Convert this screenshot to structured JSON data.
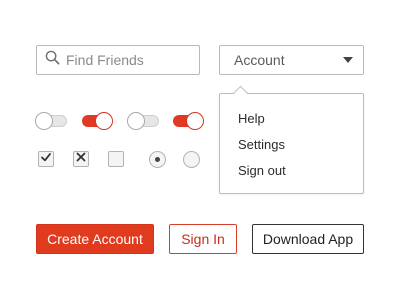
{
  "search": {
    "placeholder": "Find Friends",
    "value": "",
    "icon": "search-icon"
  },
  "account_select": {
    "selected": "Account",
    "icon": "caret-down-icon"
  },
  "account_menu": {
    "items": [
      {
        "label": "Help"
      },
      {
        "label": "Settings"
      },
      {
        "label": "Sign out"
      }
    ]
  },
  "toggles": [
    {
      "state": "off",
      "highlighted": false
    },
    {
      "state": "on",
      "highlighted": true
    },
    {
      "state": "off",
      "highlighted": false
    },
    {
      "state": "on",
      "highlighted": true
    }
  ],
  "checkboxes": [
    {
      "state": "checked",
      "icon": "check-icon"
    },
    {
      "state": "crossed",
      "icon": "cross-icon"
    },
    {
      "state": "unchecked"
    }
  ],
  "radios": [
    {
      "state": "selected"
    },
    {
      "state": "unselected"
    }
  ],
  "buttons": {
    "primary": "Create Account",
    "secondary": "Sign In",
    "tertiary": "Download App"
  },
  "colors": {
    "accent": "#e03a1f",
    "border": "#b9b9b9",
    "text": "#333333"
  }
}
